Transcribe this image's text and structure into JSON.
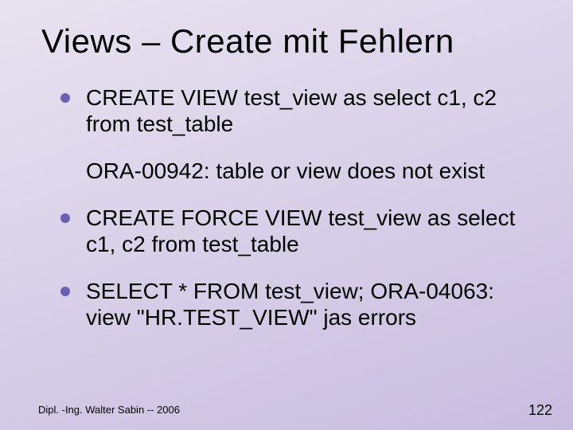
{
  "title": "Views – Create mit Fehlern",
  "bullets": [
    {
      "text": "CREATE VIEW test_view as select c1, c2 from test_table",
      "bullet": true
    },
    {
      "text": "ORA-00942: table or view does not exist",
      "bullet": false
    },
    {
      "text": "CREATE FORCE VIEW test_view as select c1, c2 from test_table",
      "bullet": true
    },
    {
      "text": "SELECT * FROM test_view; ORA-04063: view \"HR.TEST_VIEW\" jas errors",
      "bullet": true
    }
  ],
  "footer": {
    "author": "Dipl. -Ing. Walter Sabin  -- 2006",
    "page": "122"
  }
}
